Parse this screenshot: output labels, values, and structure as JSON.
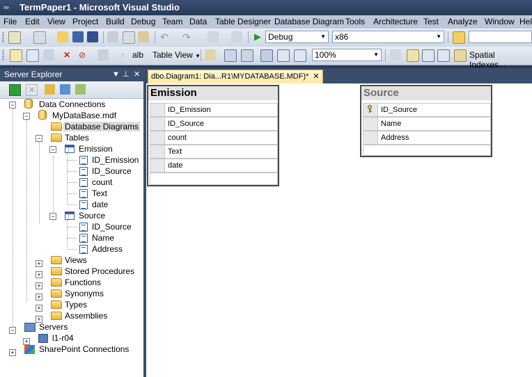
{
  "window": {
    "title": "TermPaper1 - Microsoft Visual Studio"
  },
  "menu": [
    "File",
    "Edit",
    "View",
    "Project",
    "Build",
    "Debug",
    "Team",
    "Data",
    "Table Designer",
    "Database Diagram",
    "Tools",
    "Architecture",
    "Test",
    "Analyze",
    "Window",
    "Help"
  ],
  "toolbar1": {
    "config": "Debug",
    "platform": "x86"
  },
  "toolbar2": {
    "table_view": "Table View",
    "zoom": "100%",
    "spatial": "Spatial Indexes..."
  },
  "server_explorer": {
    "title": "Server Explorer",
    "tree": {
      "data_connections": "Data Connections",
      "database": "MyDataBase.mdf",
      "database_diagrams": "Database Diagrams",
      "tables": "Tables",
      "emission": {
        "name": "Emission",
        "columns": [
          "ID_Emission",
          "ID_Source",
          "count",
          "Text",
          "date"
        ]
      },
      "source": {
        "name": "Source",
        "columns": [
          "ID_Source",
          "Name",
          "Address"
        ]
      },
      "views": "Views",
      "stored_procedures": "Stored Procedures",
      "functions": "Functions",
      "synonyms": "Synonyms",
      "types": "Types",
      "assemblies": "Assemblies",
      "servers": "Servers",
      "server_name": "l1-r04",
      "sharepoint": "SharePoint Connections"
    }
  },
  "document_tab": {
    "label": "dbo.Diagram1: Dia...R1\\MYDATABASE.MDF)*"
  },
  "diagram": {
    "emission": {
      "title": "Emission",
      "columns": [
        "ID_Emission",
        "ID_Source",
        "count",
        "Text",
        "date"
      ]
    },
    "source": {
      "title": "Source",
      "columns": [
        "ID_Source",
        "Name",
        "Address"
      ],
      "primary_key": "ID_Source"
    }
  }
}
